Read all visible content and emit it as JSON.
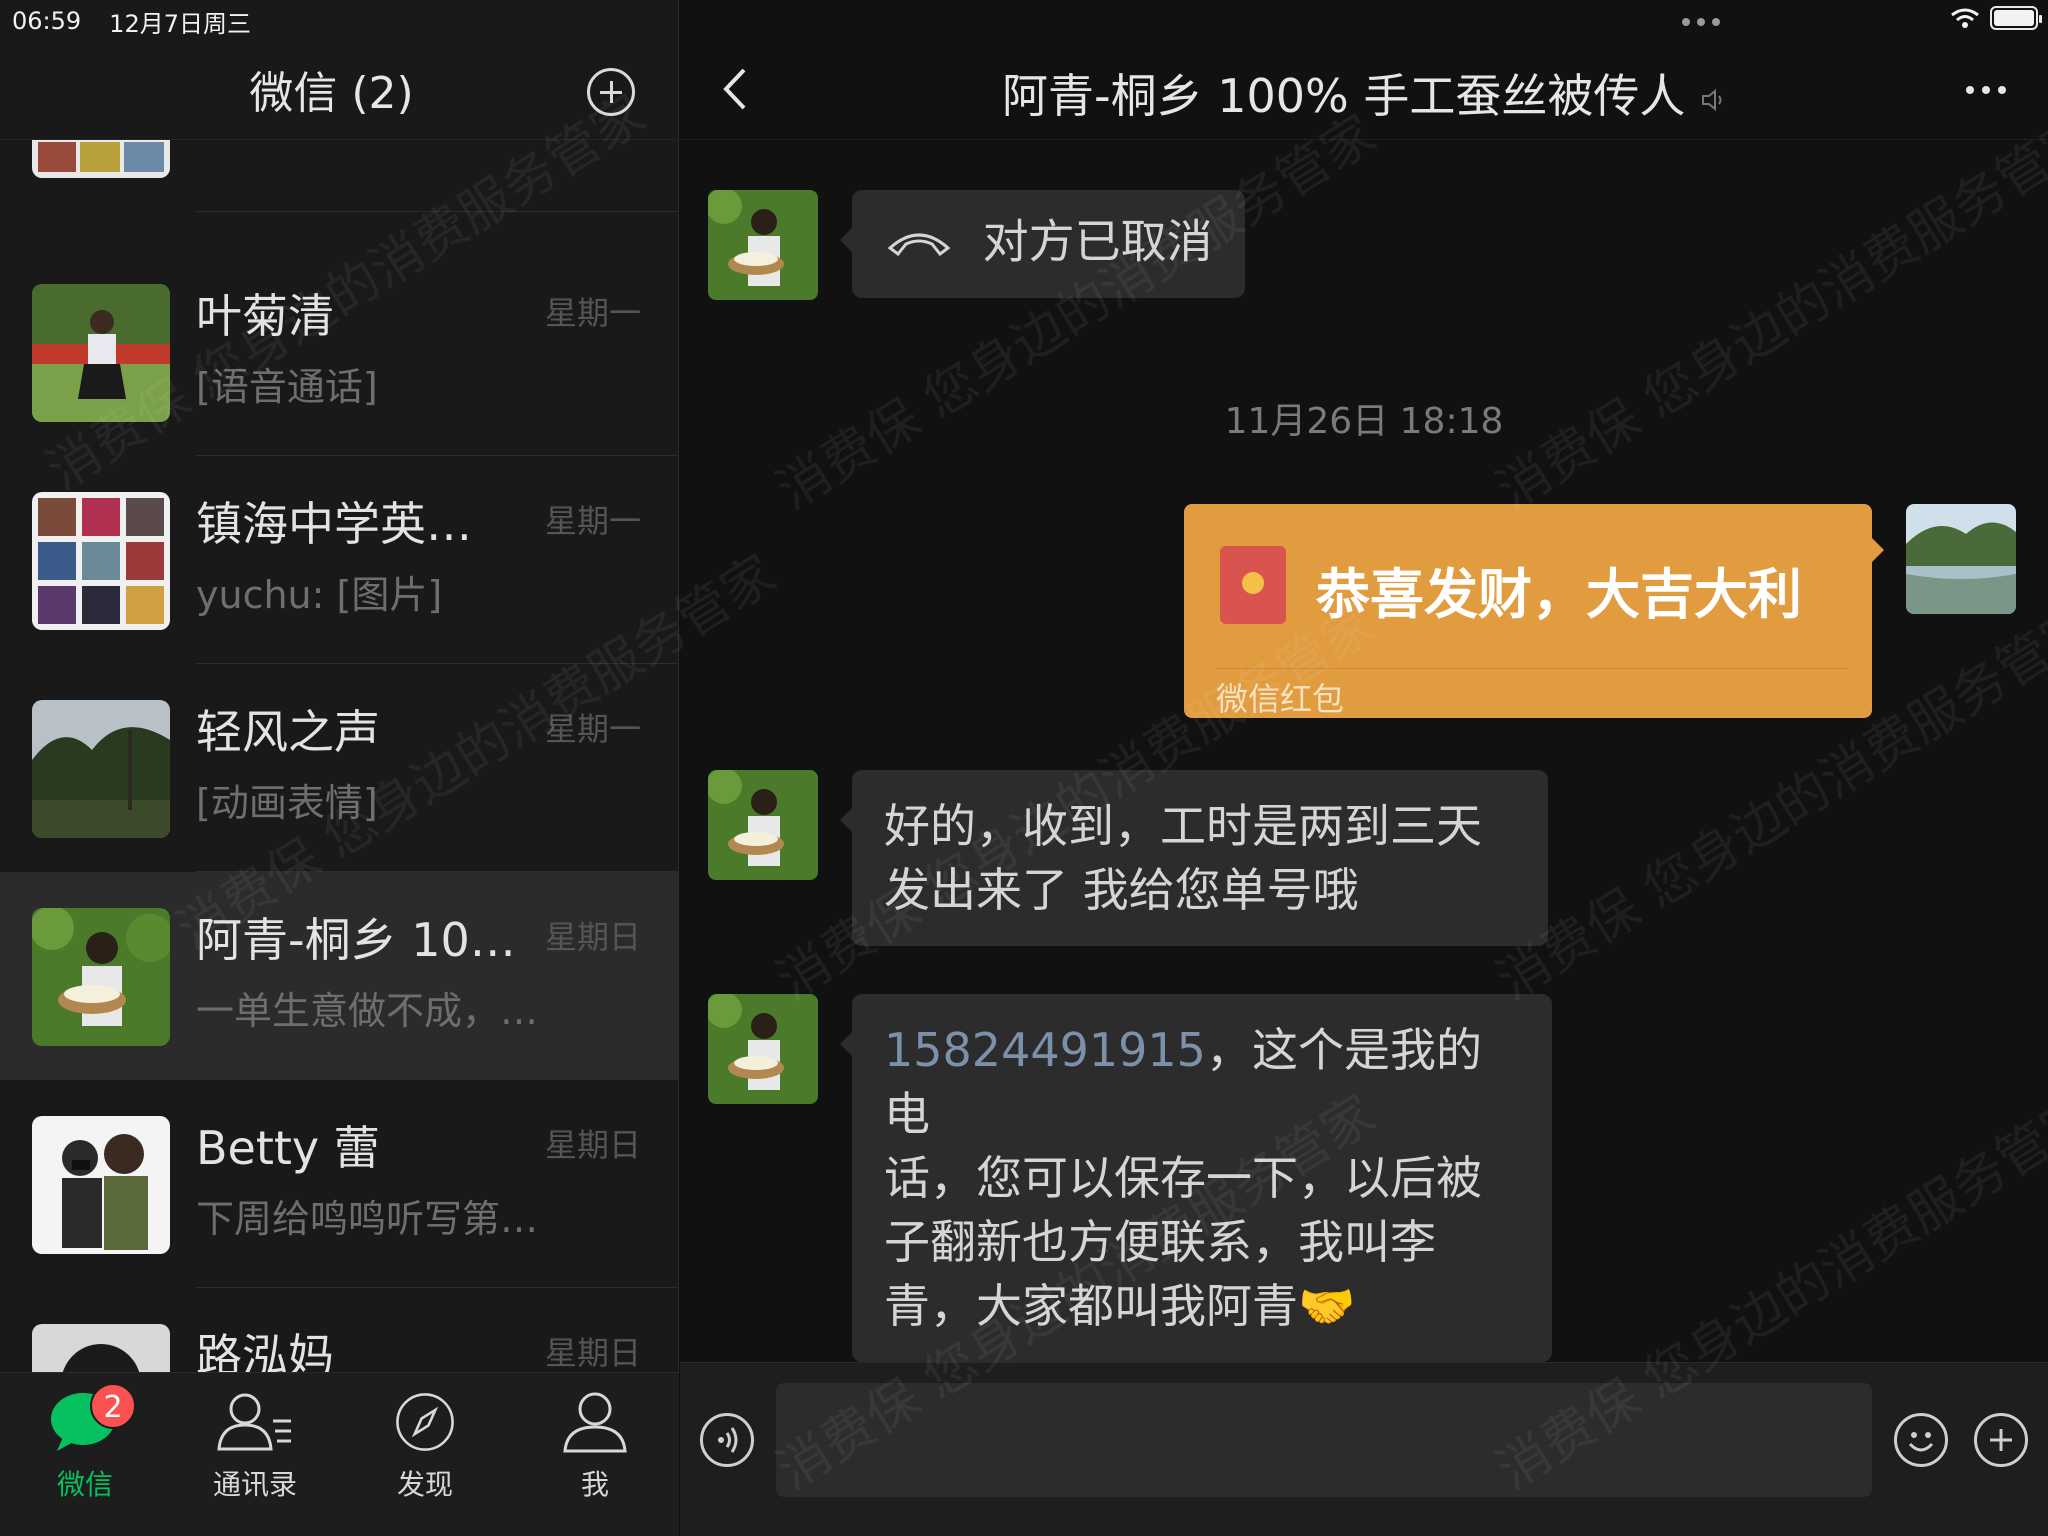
{
  "status_bar": {
    "time": "06:59",
    "date": "12月7日周三"
  },
  "sidebar": {
    "title": "微信 (2)",
    "chats": [
      {
        "name": "叶菊清",
        "preview": "[语音通话]",
        "time": "星期一"
      },
      {
        "name": "镇海中学英…",
        "preview": "yuchu: [图片]",
        "time": "星期一"
      },
      {
        "name": "轻风之声",
        "preview": "[动画表情]",
        "time": "星期一"
      },
      {
        "name": "阿青-桐乡 10…",
        "preview": "一单生意做不成，…",
        "time": "星期日"
      },
      {
        "name": "Betty 蕾",
        "preview": "下周给鸣鸣听写第…",
        "time": "星期日"
      },
      {
        "name": "路泓妈",
        "preview": "",
        "time": "星期日"
      }
    ]
  },
  "tabs": [
    {
      "label": "微信",
      "badge": "2"
    },
    {
      "label": "通讯录"
    },
    {
      "label": "发现"
    },
    {
      "label": "我"
    }
  ],
  "conversation": {
    "title": "阿青-桐乡 100% 手工蚕丝被传人",
    "call_text": "对方已取消",
    "timestamp": "11月26日 18:18",
    "red_packet": {
      "title": "恭喜发财，大吉大利",
      "label": "微信红包"
    },
    "msg1_line1": "好的，收到，工时是两到三天",
    "msg1_line2": "发出来了 我给您单号哦",
    "phone": "15824491915",
    "msg2_line1_rest": "，这个是我的电",
    "msg2_line2": "话，您可以保存一下，以后被",
    "msg2_line3": "子翻新也方便联系，我叫李",
    "msg2_line4": "青，大家都叫我阿青🤝"
  },
  "watermark": "消费保 您身边的消费服务管家",
  "colors": {
    "accent": "#07c160",
    "badge": "#fa5151",
    "red_packet": "#e19c3f",
    "link": "#7d90aa"
  }
}
